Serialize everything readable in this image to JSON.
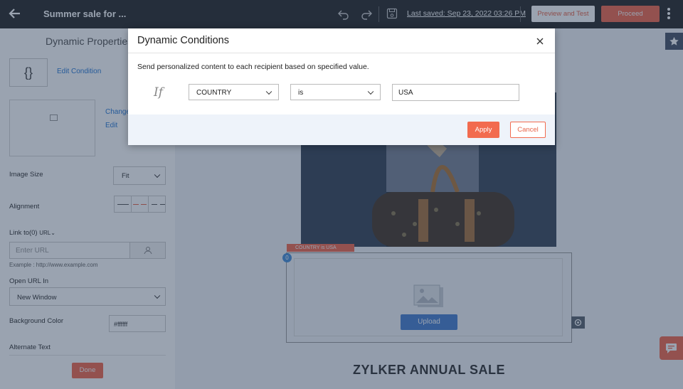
{
  "topbar": {
    "title": "Summer sale for ...",
    "last_saved": "Last saved: Sep 23, 2022 03:26 PM",
    "preview_label": "Preview and Test",
    "proceed_label": "Proceed"
  },
  "left_panel": {
    "title": "Dynamic Properties",
    "condition_icon_text": "{}",
    "edit_condition": "Edit Condition",
    "change": "Change",
    "edit": "Edit",
    "image_size_label": "Image Size",
    "image_size_value": "Fit",
    "alignment_label": "Alignment",
    "link_label": "Link to(0)",
    "link_type": "URL",
    "url_placeholder": "Enter URL",
    "url_example": "Example : http://www.example.com",
    "open_url_label": "Open URL In",
    "open_url_value": "New Window",
    "bg_color_label": "Background Color",
    "bg_color_value": "#ffffff",
    "alt_text_label": "Alternate Text",
    "done_label": "Done"
  },
  "canvas": {
    "dynamic_tag": "COUNTRY is USA",
    "block_badge": "0",
    "upload_label": "Upload",
    "sale_title": "ZYLKER ANNUAL SALE"
  },
  "modal": {
    "title": "Dynamic Conditions",
    "description": "Send personalized content to each recipient based on specified value.",
    "if_label": "If",
    "field_value": "COUNTRY",
    "operator_value": "is",
    "value_input": "USA",
    "apply_label": "Apply",
    "cancel_label": "Cancel"
  },
  "icons": [
    "back-arrow-icon",
    "undo-icon",
    "redo-icon",
    "save-icon",
    "kebab-menu-icon",
    "close-icon",
    "star-icon",
    "chat-icon",
    "gear-icon",
    "image-placeholder-icon",
    "user-icon"
  ],
  "colors": {
    "accent": "#f26b4f",
    "topbar": "#2b2b2b",
    "link": "#2b7bd6",
    "upload": "#4a80d0"
  }
}
